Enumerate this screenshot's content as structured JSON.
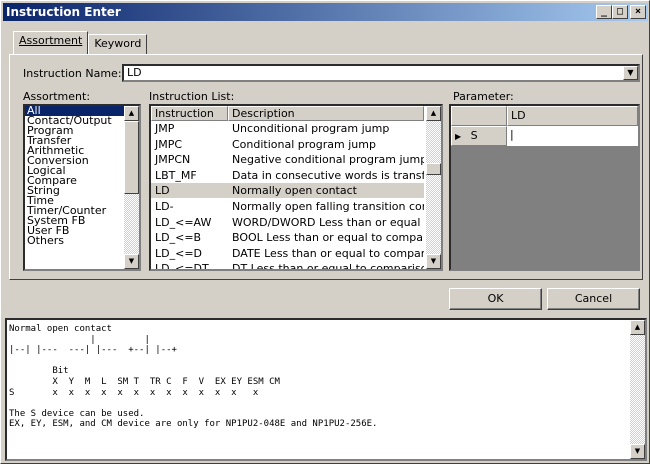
{
  "window": {
    "title": "Instruction Enter",
    "btn_min": "_",
    "btn_max": "□",
    "btn_close": "×"
  },
  "tabs": [
    {
      "label": "Assortment"
    },
    {
      "label": "Keyword"
    }
  ],
  "instruction_name": {
    "label": "Instruction Name:",
    "value": "LD"
  },
  "assortment": {
    "label": "Assortment:",
    "items": [
      "All",
      "Contact/Output",
      "Program",
      "Transfer",
      "Arithmetic",
      "Conversion",
      "Logical",
      "Compare",
      "String",
      "Time",
      "Timer/Counter",
      "System FB",
      "User FB",
      "Others"
    ],
    "selected": "All"
  },
  "instruction_list": {
    "label": "Instruction List:",
    "col_instruction": "Instruction",
    "col_description": "Description",
    "rows": [
      {
        "instruction": "JMP",
        "description": "Unconditional program jump"
      },
      {
        "instruction": "JMPC",
        "description": "Conditional program jump"
      },
      {
        "instruction": "JMPCN",
        "description": "Negative conditional program jump"
      },
      {
        "instruction": "LBT_MF",
        "description": "Data in consecutive words is transf..."
      },
      {
        "instruction": "LD",
        "description": "Normally open contact"
      },
      {
        "instruction": "LD-",
        "description": "Normally open falling transition cont..."
      },
      {
        "instruction": "LD_<=AW",
        "description": "WORD/DWORD Less than or equal ..."
      },
      {
        "instruction": "LD_<=B",
        "description": "BOOL Less than or equal to compar..."
      },
      {
        "instruction": "LD_<=D",
        "description": "DATE Less than or equal to compar..."
      },
      {
        "instruction": "LD_<=DT",
        "description": "DT Less than or equal to comparison"
      }
    ]
  },
  "parameter": {
    "label": "Parameter:",
    "column": "LD",
    "row_marker": "▶",
    "row_name": "S",
    "row_value": "|"
  },
  "buttons": {
    "ok": "OK",
    "cancel": "Cancel"
  },
  "help_text": "Normal open contact\n               |         |\n|--| |---  ---| |---  +--| |--+\n\n        Bit\n        X  Y  M  L  SM T  TR C  F  V  EX EY ESM CM\nS       x  x  x  x  x  x  x  x  x  x  x  x   x\n\nThe S device can be used.\nEX, EY, ESM, and CM device are only for NP1PU2-048E and NP1PU2-256E."
}
